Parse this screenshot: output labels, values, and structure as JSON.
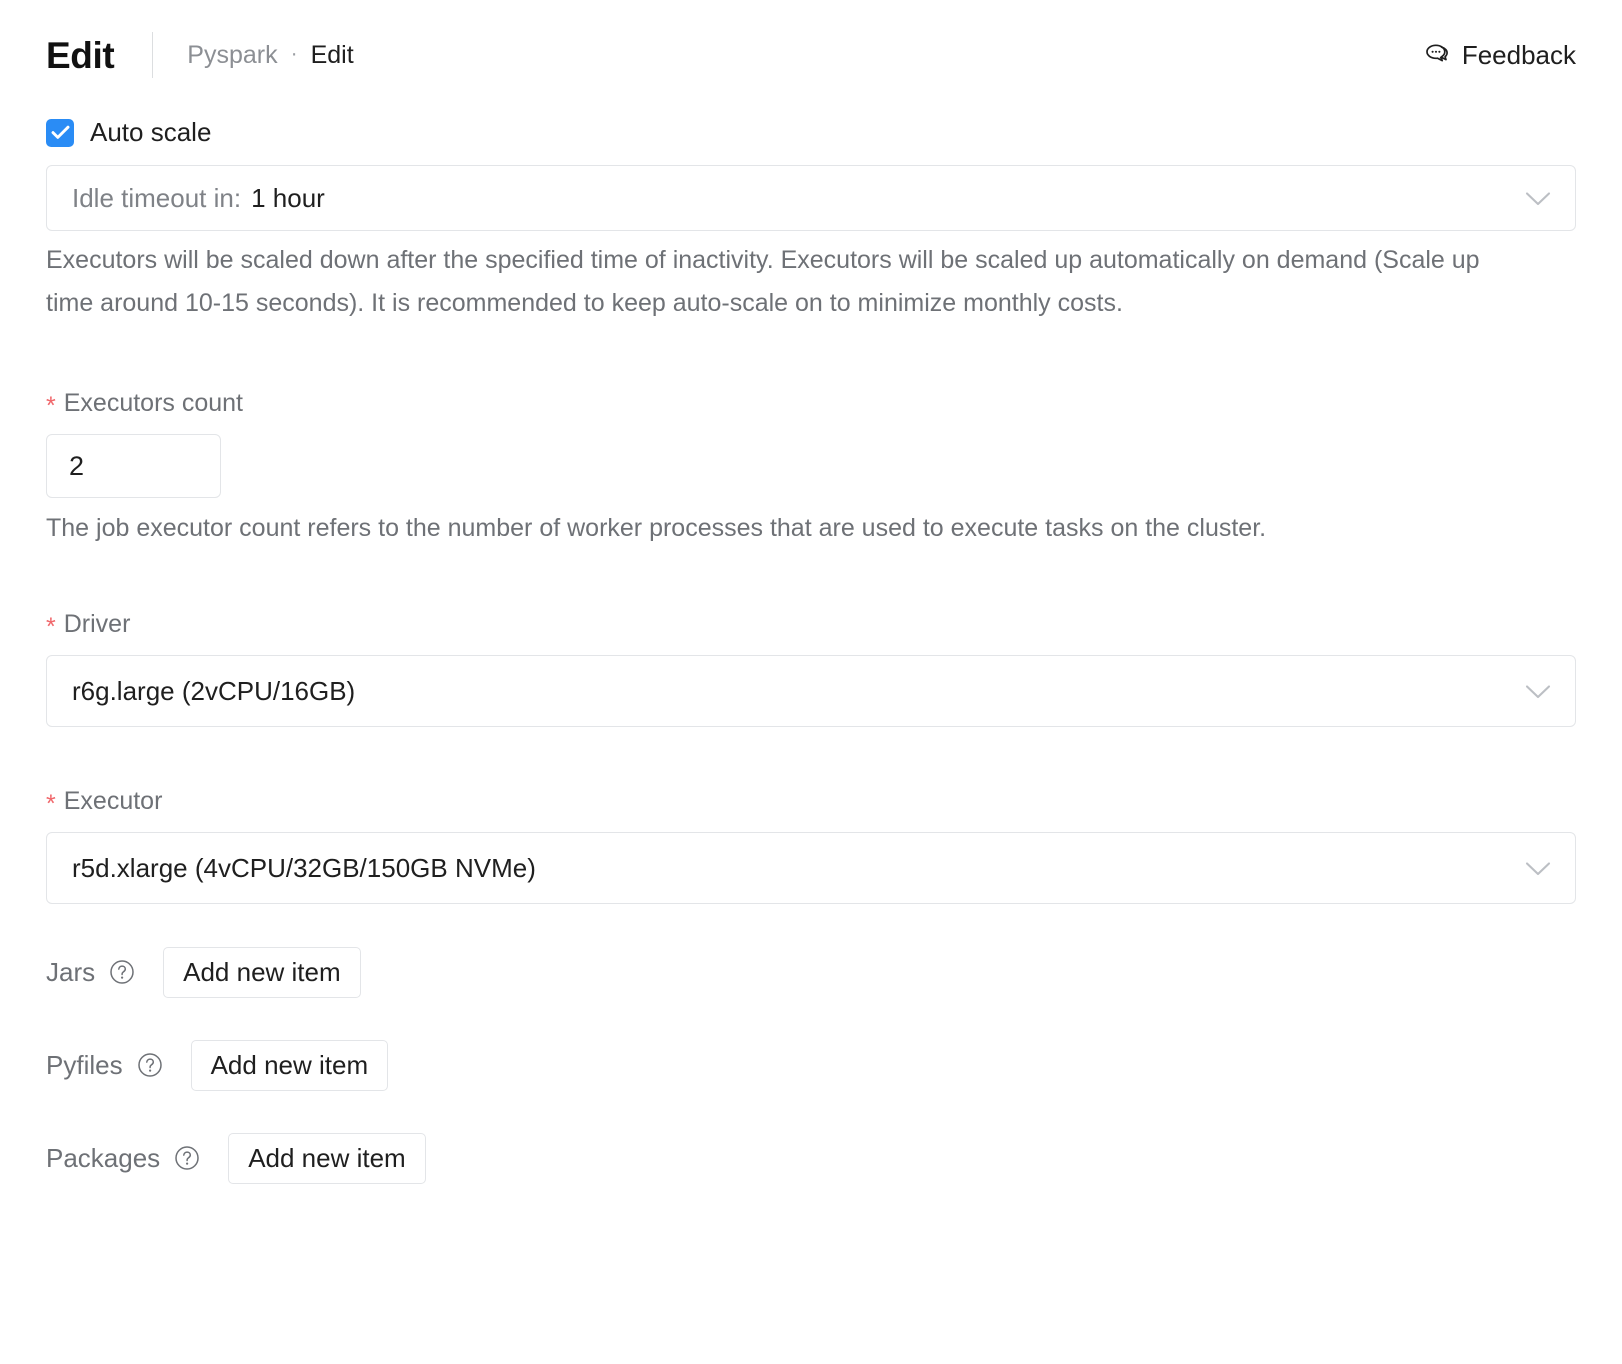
{
  "header": {
    "title": "Edit",
    "breadcrumb": {
      "parent": "Pyspark",
      "separator": "·",
      "current": "Edit"
    },
    "feedback_label": "Feedback",
    "feedback_icon": "speech-bubbles-icon"
  },
  "form": {
    "auto_scale": {
      "label": "Auto scale",
      "checked": true,
      "checkbox_color": "#2a8cf5",
      "check_icon": "check-icon"
    },
    "idle_timeout": {
      "prefix": "Idle timeout in:",
      "value": "1 hour",
      "chevron_icon": "chevron-down-icon",
      "description": "Executors will be scaled down after the specified time of inactivity. Executors will be scaled up automatically on demand (Scale up time around 10-15 seconds). It is recommended to keep auto-scale on to minimize monthly costs."
    },
    "executors_count": {
      "required_marker": "*",
      "label": "Executors count",
      "value": "2",
      "description": "The job executor count refers to the number of worker processes that are used to execute tasks on the cluster."
    },
    "driver": {
      "required_marker": "*",
      "label": "Driver",
      "value": "r6g.large (2vCPU/16GB)",
      "chevron_icon": "chevron-down-icon"
    },
    "executor": {
      "required_marker": "*",
      "label": "Executor",
      "value": "r5d.xlarge (4vCPU/32GB/150GB NVMe)",
      "chevron_icon": "chevron-down-icon"
    },
    "item_rows": [
      {
        "label": "Jars",
        "help_icon": "question-circle-icon",
        "button_label": "Add new item"
      },
      {
        "label": "Pyfiles",
        "help_icon": "question-circle-icon",
        "button_label": "Add new item"
      },
      {
        "label": "Packages",
        "help_icon": "question-circle-icon",
        "button_label": "Add new item"
      }
    ]
  },
  "colors": {
    "accent": "#2a8cf5",
    "required_star": "#f0676b",
    "border": "#e3e5e8",
    "muted_text": "#6e7176"
  }
}
